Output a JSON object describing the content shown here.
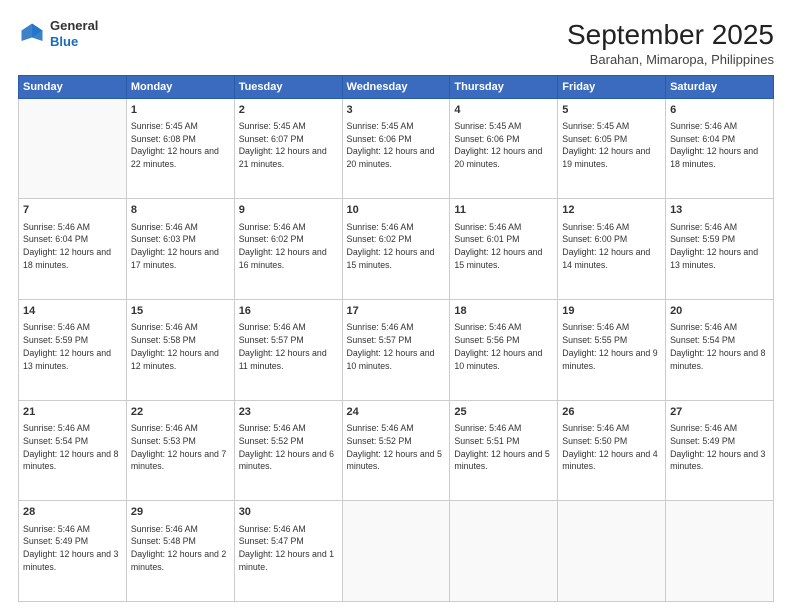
{
  "header": {
    "logo": {
      "general": "General",
      "blue": "Blue"
    },
    "month_year": "September 2025",
    "location": "Barahan, Mimaropa, Philippines"
  },
  "weekdays": [
    "Sunday",
    "Monday",
    "Tuesday",
    "Wednesday",
    "Thursday",
    "Friday",
    "Saturday"
  ],
  "weeks": [
    [
      {
        "day": "",
        "sunrise": "",
        "sunset": "",
        "daylight": ""
      },
      {
        "day": "1",
        "sunrise": "Sunrise: 5:45 AM",
        "sunset": "Sunset: 6:08 PM",
        "daylight": "Daylight: 12 hours and 22 minutes."
      },
      {
        "day": "2",
        "sunrise": "Sunrise: 5:45 AM",
        "sunset": "Sunset: 6:07 PM",
        "daylight": "Daylight: 12 hours and 21 minutes."
      },
      {
        "day": "3",
        "sunrise": "Sunrise: 5:45 AM",
        "sunset": "Sunset: 6:06 PM",
        "daylight": "Daylight: 12 hours and 20 minutes."
      },
      {
        "day": "4",
        "sunrise": "Sunrise: 5:45 AM",
        "sunset": "Sunset: 6:06 PM",
        "daylight": "Daylight: 12 hours and 20 minutes."
      },
      {
        "day": "5",
        "sunrise": "Sunrise: 5:45 AM",
        "sunset": "Sunset: 6:05 PM",
        "daylight": "Daylight: 12 hours and 19 minutes."
      },
      {
        "day": "6",
        "sunrise": "Sunrise: 5:46 AM",
        "sunset": "Sunset: 6:04 PM",
        "daylight": "Daylight: 12 hours and 18 minutes."
      }
    ],
    [
      {
        "day": "7",
        "sunrise": "Sunrise: 5:46 AM",
        "sunset": "Sunset: 6:04 PM",
        "daylight": "Daylight: 12 hours and 18 minutes."
      },
      {
        "day": "8",
        "sunrise": "Sunrise: 5:46 AM",
        "sunset": "Sunset: 6:03 PM",
        "daylight": "Daylight: 12 hours and 17 minutes."
      },
      {
        "day": "9",
        "sunrise": "Sunrise: 5:46 AM",
        "sunset": "Sunset: 6:02 PM",
        "daylight": "Daylight: 12 hours and 16 minutes."
      },
      {
        "day": "10",
        "sunrise": "Sunrise: 5:46 AM",
        "sunset": "Sunset: 6:02 PM",
        "daylight": "Daylight: 12 hours and 15 minutes."
      },
      {
        "day": "11",
        "sunrise": "Sunrise: 5:46 AM",
        "sunset": "Sunset: 6:01 PM",
        "daylight": "Daylight: 12 hours and 15 minutes."
      },
      {
        "day": "12",
        "sunrise": "Sunrise: 5:46 AM",
        "sunset": "Sunset: 6:00 PM",
        "daylight": "Daylight: 12 hours and 14 minutes."
      },
      {
        "day": "13",
        "sunrise": "Sunrise: 5:46 AM",
        "sunset": "Sunset: 5:59 PM",
        "daylight": "Daylight: 12 hours and 13 minutes."
      }
    ],
    [
      {
        "day": "14",
        "sunrise": "Sunrise: 5:46 AM",
        "sunset": "Sunset: 5:59 PM",
        "daylight": "Daylight: 12 hours and 13 minutes."
      },
      {
        "day": "15",
        "sunrise": "Sunrise: 5:46 AM",
        "sunset": "Sunset: 5:58 PM",
        "daylight": "Daylight: 12 hours and 12 minutes."
      },
      {
        "day": "16",
        "sunrise": "Sunrise: 5:46 AM",
        "sunset": "Sunset: 5:57 PM",
        "daylight": "Daylight: 12 hours and 11 minutes."
      },
      {
        "day": "17",
        "sunrise": "Sunrise: 5:46 AM",
        "sunset": "Sunset: 5:57 PM",
        "daylight": "Daylight: 12 hours and 10 minutes."
      },
      {
        "day": "18",
        "sunrise": "Sunrise: 5:46 AM",
        "sunset": "Sunset: 5:56 PM",
        "daylight": "Daylight: 12 hours and 10 minutes."
      },
      {
        "day": "19",
        "sunrise": "Sunrise: 5:46 AM",
        "sunset": "Sunset: 5:55 PM",
        "daylight": "Daylight: 12 hours and 9 minutes."
      },
      {
        "day": "20",
        "sunrise": "Sunrise: 5:46 AM",
        "sunset": "Sunset: 5:54 PM",
        "daylight": "Daylight: 12 hours and 8 minutes."
      }
    ],
    [
      {
        "day": "21",
        "sunrise": "Sunrise: 5:46 AM",
        "sunset": "Sunset: 5:54 PM",
        "daylight": "Daylight: 12 hours and 8 minutes."
      },
      {
        "day": "22",
        "sunrise": "Sunrise: 5:46 AM",
        "sunset": "Sunset: 5:53 PM",
        "daylight": "Daylight: 12 hours and 7 minutes."
      },
      {
        "day": "23",
        "sunrise": "Sunrise: 5:46 AM",
        "sunset": "Sunset: 5:52 PM",
        "daylight": "Daylight: 12 hours and 6 minutes."
      },
      {
        "day": "24",
        "sunrise": "Sunrise: 5:46 AM",
        "sunset": "Sunset: 5:52 PM",
        "daylight": "Daylight: 12 hours and 5 minutes."
      },
      {
        "day": "25",
        "sunrise": "Sunrise: 5:46 AM",
        "sunset": "Sunset: 5:51 PM",
        "daylight": "Daylight: 12 hours and 5 minutes."
      },
      {
        "day": "26",
        "sunrise": "Sunrise: 5:46 AM",
        "sunset": "Sunset: 5:50 PM",
        "daylight": "Daylight: 12 hours and 4 minutes."
      },
      {
        "day": "27",
        "sunrise": "Sunrise: 5:46 AM",
        "sunset": "Sunset: 5:49 PM",
        "daylight": "Daylight: 12 hours and 3 minutes."
      }
    ],
    [
      {
        "day": "28",
        "sunrise": "Sunrise: 5:46 AM",
        "sunset": "Sunset: 5:49 PM",
        "daylight": "Daylight: 12 hours and 3 minutes."
      },
      {
        "day": "29",
        "sunrise": "Sunrise: 5:46 AM",
        "sunset": "Sunset: 5:48 PM",
        "daylight": "Daylight: 12 hours and 2 minutes."
      },
      {
        "day": "30",
        "sunrise": "Sunrise: 5:46 AM",
        "sunset": "Sunset: 5:47 PM",
        "daylight": "Daylight: 12 hours and 1 minute."
      },
      {
        "day": "",
        "sunrise": "",
        "sunset": "",
        "daylight": ""
      },
      {
        "day": "",
        "sunrise": "",
        "sunset": "",
        "daylight": ""
      },
      {
        "day": "",
        "sunrise": "",
        "sunset": "",
        "daylight": ""
      },
      {
        "day": "",
        "sunrise": "",
        "sunset": "",
        "daylight": ""
      }
    ]
  ]
}
